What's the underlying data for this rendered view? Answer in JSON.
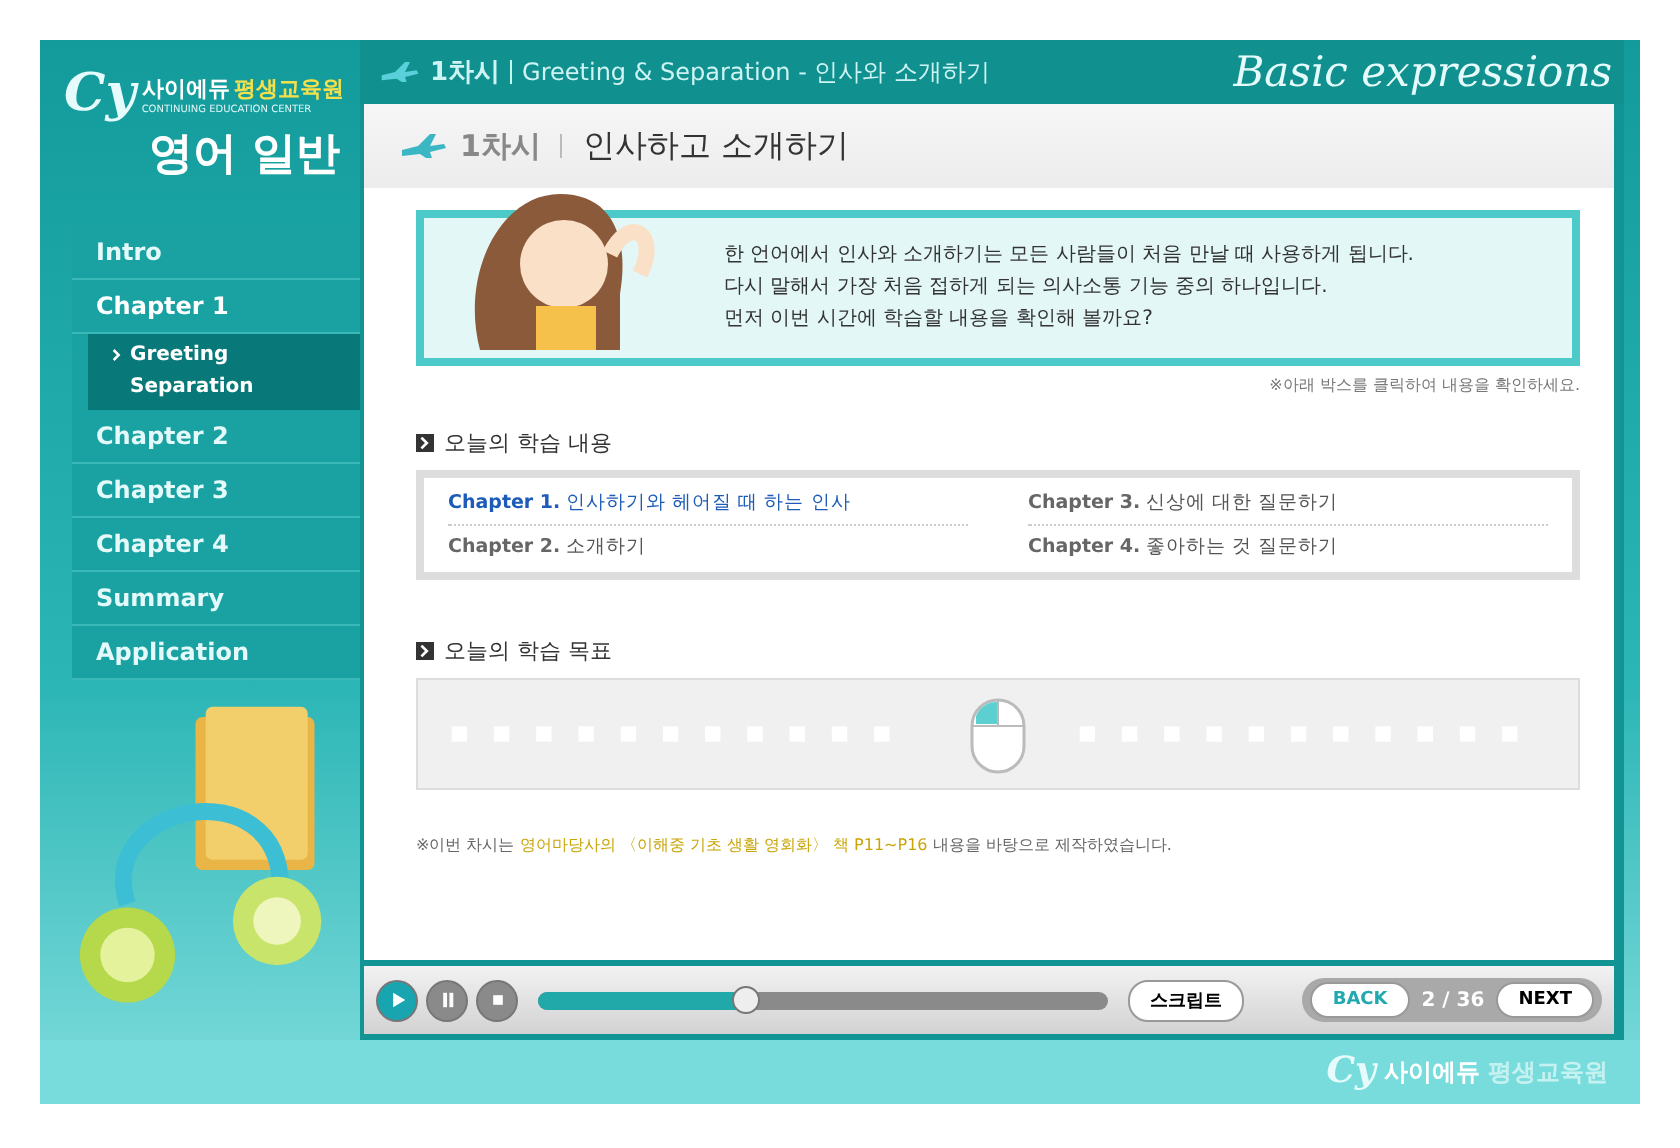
{
  "brand": {
    "mark": "Cy",
    "name": "사이에듀",
    "name_highlight": "평생교육원",
    "subtitle": "CONTINUING EDUCATION CENTER",
    "course": "영어 일반"
  },
  "sidebar": {
    "items": [
      {
        "label": "Intro",
        "selected": false
      },
      {
        "label": "Chapter 1",
        "selected": true,
        "children": [
          {
            "label": "Greeting Separation",
            "selected": true
          }
        ]
      },
      {
        "label": "Chapter 2",
        "selected": false
      },
      {
        "label": "Chapter 3",
        "selected": false
      },
      {
        "label": "Chapter 4",
        "selected": false
      },
      {
        "label": "Summary",
        "selected": false
      },
      {
        "label": "Application",
        "selected": false
      }
    ]
  },
  "header": {
    "lesson": "1차시",
    "title": "Greeting & Separation - 인사와 소개하기",
    "tagline": "Basic expressions"
  },
  "page_title": {
    "lesson": "1차시",
    "title": "인사하고 소개하기"
  },
  "intro": {
    "lines": [
      "한 언어에서 인사와 소개하기는 모든 사람들이 처음 만날 때 사용하게 됩니다.",
      "다시 말해서 가장 처음 접하게 되는 의사소통 기능 중의 하나입니다.",
      "먼저 이번 시간에 학습할 내용을 확인해 볼까요?"
    ],
    "hint": "※아래 박스를 클릭하여 내용을 확인하세요."
  },
  "contents": {
    "heading": "오늘의 학습 내용",
    "items": [
      {
        "chapter": "Chapter 1.",
        "title": "인사하기와 헤어질 때 하는 인사",
        "selected": true
      },
      {
        "chapter": "Chapter 3.",
        "title": "신상에 대한 질문하기",
        "selected": false
      },
      {
        "chapter": "Chapter 2.",
        "title": "소개하기",
        "selected": false
      },
      {
        "chapter": "Chapter 4.",
        "title": "좋아하는 것 질문하기",
        "selected": false
      }
    ]
  },
  "goals": {
    "heading": "오늘의 학습 목표"
  },
  "source_note": {
    "prefix": "※이번 차시는",
    "highlight": "영어마당사의 〈이해중 기초 생활 영회화〉 책 P11~P16",
    "suffix": "내용을 바탕으로 제작하였습니다."
  },
  "player": {
    "level": 0.37,
    "script_button": "스크립트",
    "back": "BACK",
    "page": "2 / 36",
    "next": "NEXT"
  },
  "footer_brand": {
    "mark": "Cy",
    "name": "사이에듀",
    "name_highlight": "평생교육원"
  }
}
